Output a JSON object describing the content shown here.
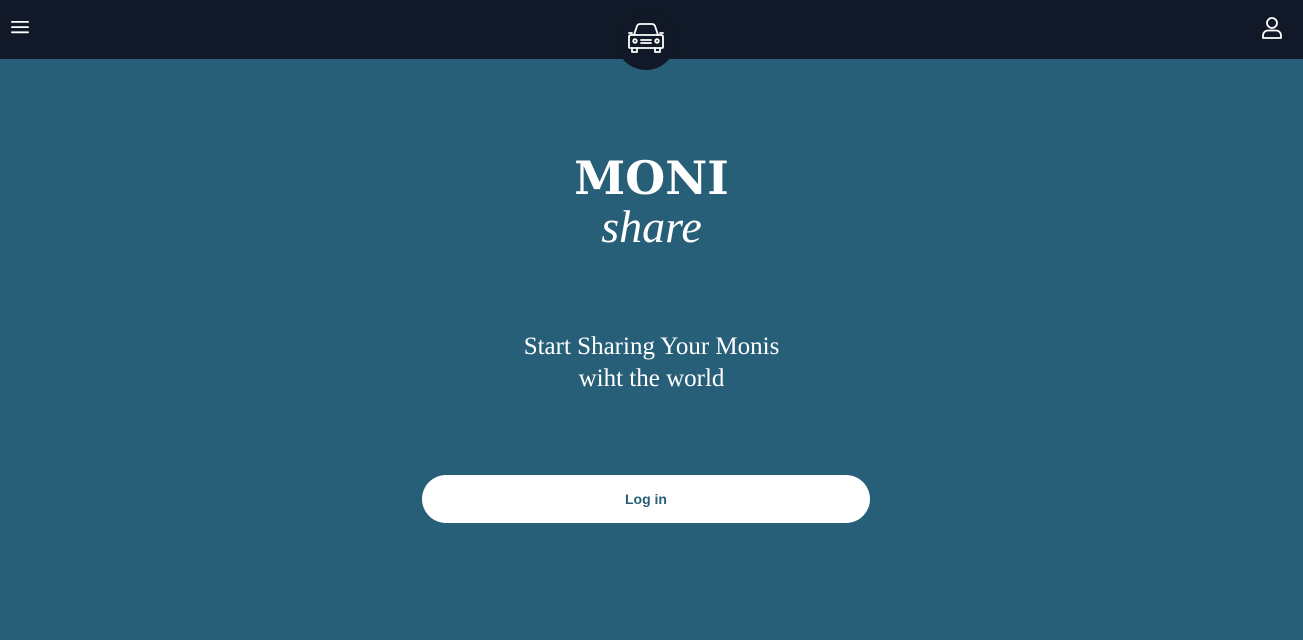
{
  "header": {
    "menu_icon": "hamburger-menu-icon",
    "logo_icon": "car-icon",
    "user_icon": "user-icon",
    "background_color": "#111827"
  },
  "brand": {
    "main": "MONI",
    "sub": "share"
  },
  "tagline": {
    "line1": "Start Sharing Your Monis",
    "line2": "wiht the world"
  },
  "login": {
    "label": "Log in"
  },
  "colors": {
    "page_background": "#275e78",
    "button_background": "#ffffff",
    "button_text": "#275e78"
  }
}
